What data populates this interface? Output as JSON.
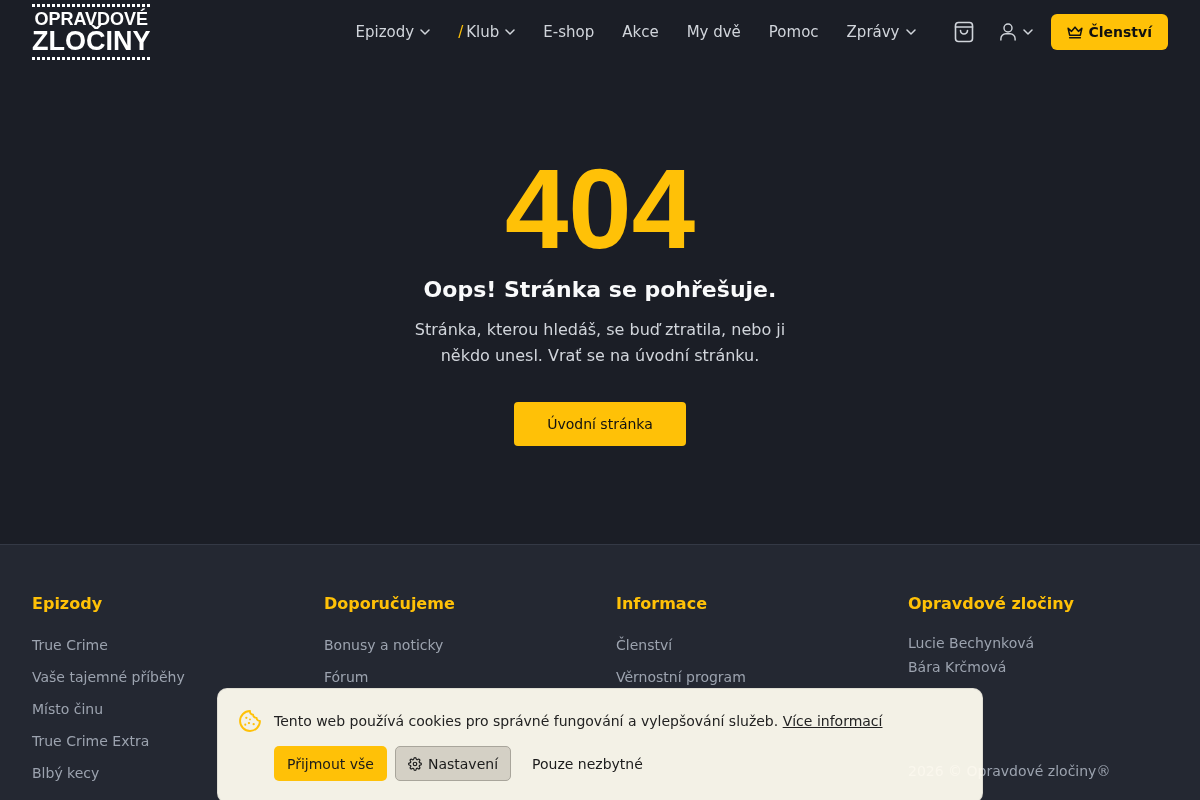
{
  "header": {
    "logo": {
      "lines": [
        "OPRAVDOVÉ",
        "ZLOČINY"
      ]
    },
    "nav": [
      {
        "label": "Epizody",
        "has_menu": true
      },
      {
        "label": "Klub",
        "prefix": "/",
        "has_menu": true
      },
      {
        "label": "E-shop",
        "has_menu": false
      },
      {
        "label": "Akce",
        "has_menu": false
      },
      {
        "label": "My dvě",
        "has_menu": false
      },
      {
        "label": "Pomoc",
        "has_menu": false
      },
      {
        "label": "Zprávy",
        "has_menu": true
      }
    ],
    "membership_button": {
      "label": "Členství"
    }
  },
  "error": {
    "code": "404",
    "title": "Oops! Stránka se pohřešuje.",
    "message": "Stránka, kterou hledáš, se buď ztratila, nebo ji někdo unesl. Vrať se na úvodní stránku.",
    "button": "Úvodní stránka"
  },
  "footer": {
    "columns": [
      {
        "kind": "links",
        "heading": "Epizody",
        "links": [
          "True Crime",
          "Vaše tajemné příběhy",
          "Místo činu",
          "True Crime Extra",
          "Blbý kecy"
        ]
      },
      {
        "kind": "links",
        "heading": "Doporučujeme",
        "links": [
          "Bonusy a noticky",
          "Fórum"
        ]
      },
      {
        "kind": "links",
        "heading": "Informace",
        "links": [
          "Členství",
          "Věrnostní program"
        ]
      },
      {
        "kind": "about",
        "heading": "Opravdové zločiny",
        "names": [
          "Lucie Bechynková",
          "Bára Krčmová"
        ],
        "copyright": "2026 © Opravdové zločiny®"
      }
    ]
  },
  "cookie_banner": {
    "text": "Tento web používá cookies pro správné fungování a vylepšování služeb.",
    "link": "Více informací",
    "buttons": [
      {
        "label": "Přijmout vše",
        "kind": "primary"
      },
      {
        "label": "Nastavení",
        "kind": "settings"
      },
      {
        "label": "Pouze nezbytné",
        "kind": "plain"
      }
    ]
  }
}
